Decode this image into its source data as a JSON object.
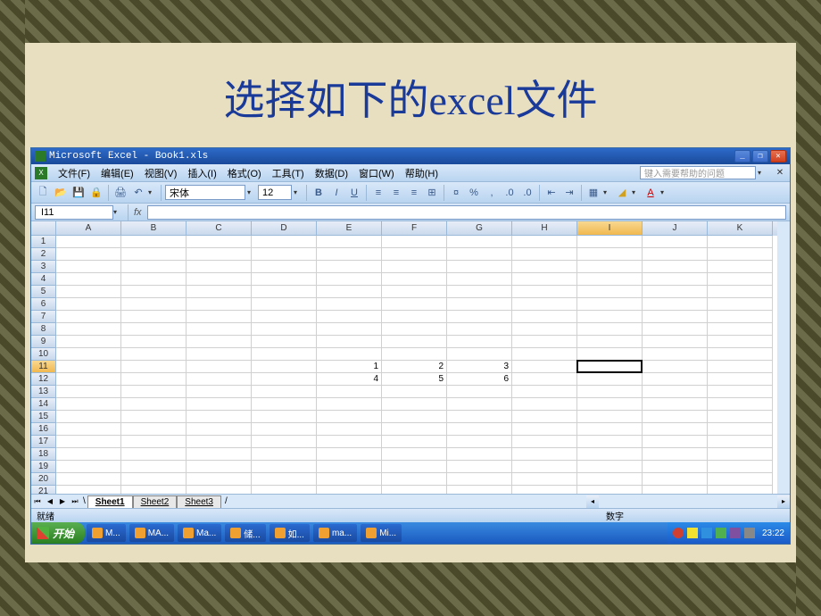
{
  "slide": {
    "title": "选择如下的excel文件"
  },
  "window": {
    "title": "Microsoft Excel - Book1.xls",
    "help_placeholder": "键入需要帮助的问题"
  },
  "menus": [
    "文件(F)",
    "编辑(E)",
    "视图(V)",
    "插入(I)",
    "格式(O)",
    "工具(T)",
    "数据(D)",
    "窗口(W)",
    "帮助(H)"
  ],
  "toolbar": {
    "font_name": "宋体",
    "font_size": "12"
  },
  "namebox": {
    "cell_ref": "I11"
  },
  "grid": {
    "columns": [
      "A",
      "B",
      "C",
      "D",
      "E",
      "F",
      "G",
      "H",
      "I",
      "J",
      "K"
    ],
    "selected_col": "I",
    "selected_row": 11,
    "active_cell": "I11",
    "num_rows": 21,
    "data": {
      "11": {
        "E": "1",
        "F": "2",
        "G": "3"
      },
      "12": {
        "E": "4",
        "F": "5",
        "G": "6"
      }
    }
  },
  "sheets": {
    "tabs": [
      "Sheet1",
      "Sheet2",
      "Sheet3"
    ],
    "active": "Sheet1"
  },
  "statusbar": {
    "left": "就绪",
    "right": "数字"
  },
  "taskbar": {
    "start": "开始",
    "items": [
      "M...",
      "MA...",
      "Ma...",
      "储...",
      "如...",
      "ma...",
      "Mi..."
    ],
    "clock": "23:22"
  }
}
